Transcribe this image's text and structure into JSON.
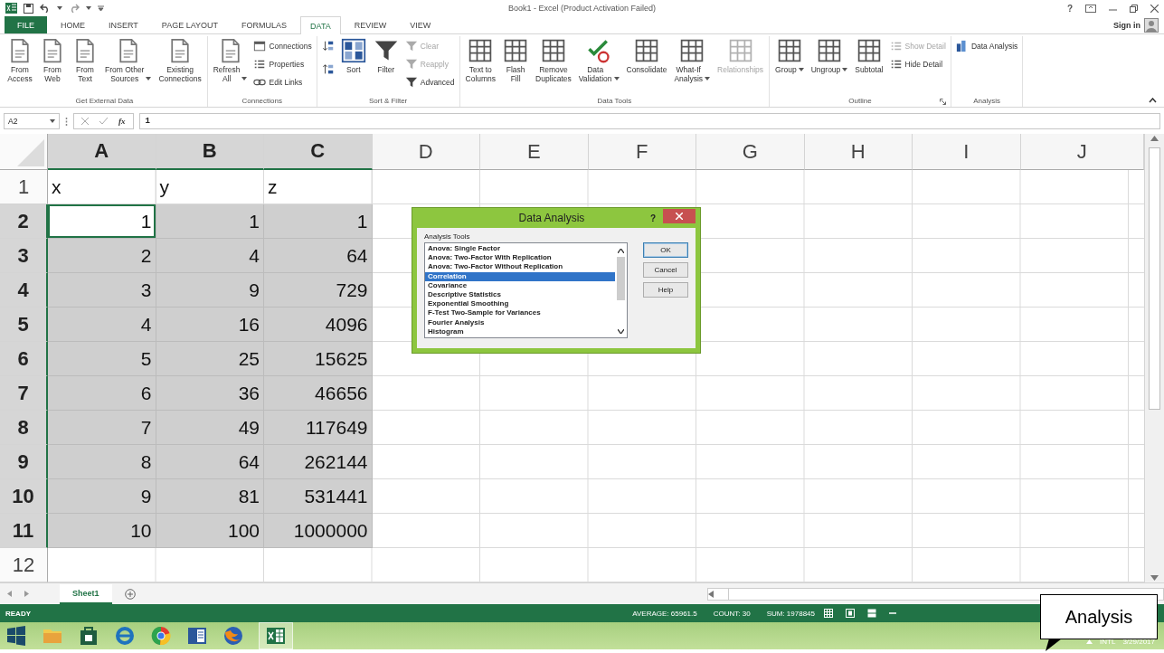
{
  "title_bar": {
    "title": "Book1 - Excel (Product Activation Failed)",
    "help": "?"
  },
  "tabs": [
    {
      "label": "FILE",
      "kind": "file",
      "selected": false
    },
    {
      "label": "HOME",
      "kind": "tab",
      "selected": false
    },
    {
      "label": "INSERT",
      "kind": "tab",
      "selected": false
    },
    {
      "label": "PAGE LAYOUT",
      "kind": "tab",
      "selected": false
    },
    {
      "label": "FORMULAS",
      "kind": "tab",
      "selected": false
    },
    {
      "label": "DATA",
      "kind": "tab",
      "selected": true
    },
    {
      "label": "REVIEW",
      "kind": "tab",
      "selected": false
    },
    {
      "label": "VIEW",
      "kind": "tab",
      "selected": false
    }
  ],
  "account": {
    "label": "Sign in"
  },
  "ribbon": {
    "groups": [
      {
        "label": "Get External Data",
        "items": [
          {
            "label": "From\nAccess",
            "kind": "large",
            "dropdown": false,
            "disabled": false
          },
          {
            "label": "From\nWeb",
            "kind": "large",
            "dropdown": false,
            "disabled": false
          },
          {
            "label": "From\nText",
            "kind": "large",
            "dropdown": false,
            "disabled": false
          },
          {
            "label": "From Other\nSources",
            "kind": "large",
            "dropdown": true,
            "disabled": false
          },
          {
            "label": "Existing\nConnections",
            "kind": "large",
            "dropdown": false,
            "disabled": false
          }
        ]
      },
      {
        "label": "Connections",
        "items": [
          {
            "label": "Refresh\nAll",
            "kind": "large",
            "dropdown": true,
            "disabled": false
          },
          {
            "label": "Connections",
            "kind": "small",
            "dropdown": false,
            "disabled": false
          },
          {
            "label": "Properties",
            "kind": "small",
            "dropdown": false,
            "disabled": false
          },
          {
            "label": "Edit Links",
            "kind": "small",
            "dropdown": false,
            "disabled": false
          }
        ]
      },
      {
        "label": "Sort & Filter",
        "items": [
          {
            "kind": "sort-pair",
            "disabled": false
          },
          {
            "label": "Sort",
            "kind": "large",
            "dropdown": false,
            "disabled": false
          },
          {
            "label": "Filter",
            "kind": "large",
            "dropdown": false,
            "disabled": false
          },
          {
            "label": "Clear",
            "kind": "small",
            "dropdown": false,
            "disabled": true
          },
          {
            "label": "Reapply",
            "kind": "small",
            "dropdown": false,
            "disabled": true
          },
          {
            "label": "Advanced",
            "kind": "small",
            "dropdown": false,
            "disabled": false
          }
        ]
      },
      {
        "label": "Data Tools",
        "items": [
          {
            "label": "Text to\nColumns",
            "kind": "large",
            "dropdown": false,
            "disabled": false
          },
          {
            "label": "Flash\nFill",
            "kind": "large",
            "dropdown": false,
            "disabled": false
          },
          {
            "label": "Remove\nDuplicates",
            "kind": "large",
            "dropdown": false,
            "disabled": false
          },
          {
            "label": "Data\nValidation",
            "kind": "large",
            "dropdown": true,
            "disabled": false
          },
          {
            "label": "Consolidate",
            "kind": "large",
            "dropdown": false,
            "disabled": false
          },
          {
            "label": "What-If\nAnalysis",
            "kind": "large",
            "dropdown": true,
            "disabled": false
          },
          {
            "label": "Relationships",
            "kind": "large",
            "dropdown": false,
            "disabled": true
          }
        ]
      },
      {
        "label": "Outline",
        "launcher": true,
        "items": [
          {
            "label": "Group",
            "kind": "large",
            "dropdown": true,
            "disabled": false
          },
          {
            "label": "Ungroup",
            "kind": "large",
            "dropdown": true,
            "disabled": false
          },
          {
            "label": "Subtotal",
            "kind": "large",
            "dropdown": false,
            "disabled": false
          },
          {
            "label": "Show Detail",
            "kind": "small",
            "dropdown": false,
            "disabled": true
          },
          {
            "label": "Hide Detail",
            "kind": "small",
            "dropdown": false,
            "disabled": false
          }
        ]
      },
      {
        "label": "Analysis",
        "items": [
          {
            "label": "Data Analysis",
            "kind": "small",
            "dropdown": false,
            "disabled": false
          }
        ]
      }
    ]
  },
  "formula_bar": {
    "name_box": "A2",
    "function_label": "fx",
    "value": "1"
  },
  "sheet": {
    "columns": [
      {
        "label": "A",
        "selected": true
      },
      {
        "label": "B",
        "selected": true
      },
      {
        "label": "C",
        "selected": true
      },
      {
        "label": "D",
        "selected": false
      },
      {
        "label": "E",
        "selected": false
      },
      {
        "label": "F",
        "selected": false
      },
      {
        "label": "G",
        "selected": false
      },
      {
        "label": "H",
        "selected": false
      },
      {
        "label": "I",
        "selected": false
      },
      {
        "label": "J",
        "selected": false
      }
    ],
    "rows": [
      {
        "number": "1",
        "selected": false,
        "kind": "text",
        "cells": [
          {
            "value": "x",
            "active": false
          },
          {
            "value": "y",
            "active": false
          },
          {
            "value": "z",
            "active": false
          }
        ]
      },
      {
        "number": "2",
        "selected": true,
        "kind": "number",
        "cells": [
          {
            "value": "1",
            "active": true
          },
          {
            "value": "1",
            "active": false
          },
          {
            "value": "1",
            "active": false
          }
        ]
      },
      {
        "number": "3",
        "selected": true,
        "kind": "number",
        "cells": [
          {
            "value": "2",
            "active": false
          },
          {
            "value": "4",
            "active": false
          },
          {
            "value": "64",
            "active": false
          }
        ]
      },
      {
        "number": "4",
        "selected": true,
        "kind": "number",
        "cells": [
          {
            "value": "3",
            "active": false
          },
          {
            "value": "9",
            "active": false
          },
          {
            "value": "729",
            "active": false
          }
        ]
      },
      {
        "number": "5",
        "selected": true,
        "kind": "number",
        "cells": [
          {
            "value": "4",
            "active": false
          },
          {
            "value": "16",
            "active": false
          },
          {
            "value": "4096",
            "active": false
          }
        ]
      },
      {
        "number": "6",
        "selected": true,
        "kind": "number",
        "cells": [
          {
            "value": "5",
            "active": false
          },
          {
            "value": "25",
            "active": false
          },
          {
            "value": "15625",
            "active": false
          }
        ]
      },
      {
        "number": "7",
        "selected": true,
        "kind": "number",
        "cells": [
          {
            "value": "6",
            "active": false
          },
          {
            "value": "36",
            "active": false
          },
          {
            "value": "46656",
            "active": false
          }
        ]
      },
      {
        "number": "8",
        "selected": true,
        "kind": "number",
        "cells": [
          {
            "value": "7",
            "active": false
          },
          {
            "value": "49",
            "active": false
          },
          {
            "value": "117649",
            "active": false
          }
        ]
      },
      {
        "number": "9",
        "selected": true,
        "kind": "number",
        "cells": [
          {
            "value": "8",
            "active": false
          },
          {
            "value": "64",
            "active": false
          },
          {
            "value": "262144",
            "active": false
          }
        ]
      },
      {
        "number": "10",
        "selected": true,
        "kind": "number",
        "cells": [
          {
            "value": "9",
            "active": false
          },
          {
            "value": "81",
            "active": false
          },
          {
            "value": "531441",
            "active": false
          }
        ]
      },
      {
        "number": "11",
        "selected": true,
        "kind": "number",
        "cells": [
          {
            "value": "10",
            "active": false
          },
          {
            "value": "100",
            "active": false
          },
          {
            "value": "1000000",
            "active": false
          }
        ]
      },
      {
        "number": "12",
        "selected": false,
        "kind": "text"
      }
    ]
  },
  "dialog": {
    "title": "Data Analysis",
    "help": "?",
    "list_label": "Analysis Tools",
    "tools": [
      {
        "label": "Anova: Single Factor",
        "selected": false
      },
      {
        "label": "Anova: Two-Factor With Replication",
        "selected": false
      },
      {
        "label": "Anova: Two-Factor Without Replication",
        "selected": false
      },
      {
        "label": "Correlation",
        "selected": true
      },
      {
        "label": "Covariance",
        "selected": false
      },
      {
        "label": "Descriptive Statistics",
        "selected": false
      },
      {
        "label": "Exponential Smoothing",
        "selected": false
      },
      {
        "label": "F-Test Two-Sample for Variances",
        "selected": false
      },
      {
        "label": "Fourier Analysis",
        "selected": false
      },
      {
        "label": "Histogram",
        "selected": false
      }
    ],
    "buttons": [
      {
        "label": "OK",
        "kind": "default"
      },
      {
        "label": "Cancel",
        "kind": "normal"
      },
      {
        "label": "Help",
        "kind": "normal"
      }
    ]
  },
  "sheet_tabs": [
    {
      "label": "Sheet1",
      "selected": true
    }
  ],
  "status_bar": {
    "mode": "READY",
    "stats": [
      "AVERAGE: 65961.5",
      "COUNT: 30",
      "SUM: 1978845"
    ]
  },
  "taskbar": {
    "tray": [
      "INTL",
      "3/29/2017"
    ]
  },
  "callout": {
    "text": "Analysis"
  }
}
